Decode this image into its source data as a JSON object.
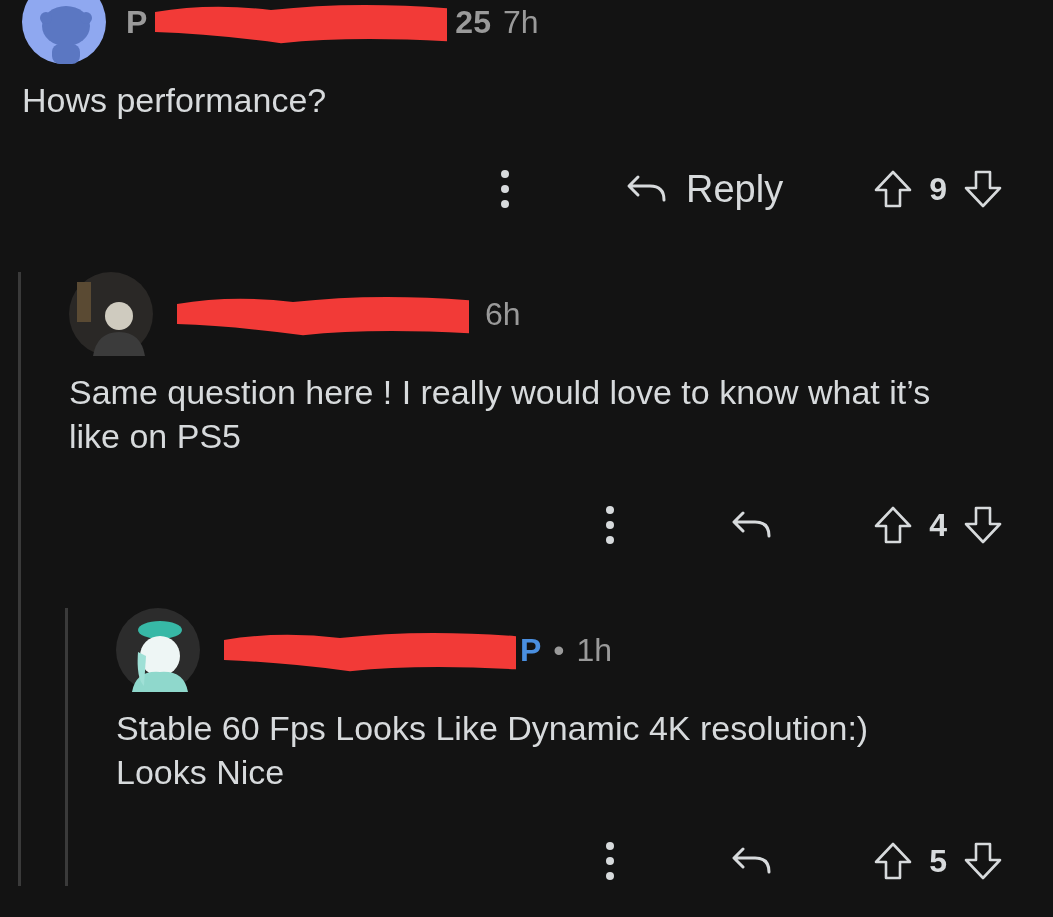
{
  "comments": [
    {
      "avatar": {
        "kind": "robot"
      },
      "name_parts": [
        {
          "kind": "text",
          "text": "P"
        },
        {
          "kind": "redaction"
        },
        {
          "kind": "text",
          "text": "25"
        }
      ],
      "time": "7h",
      "body": "Hows performance?",
      "reply_label": "Reply",
      "score": "9",
      "children": [
        {
          "avatar": {
            "kind": "masked"
          },
          "name_parts": [
            {
              "kind": "redaction"
            }
          ],
          "time": "6h",
          "body": "Same question here ! I really would love to know what it’s like on PS5",
          "score": "4",
          "children": [
            {
              "avatar": {
                "kind": "character"
              },
              "name_parts": [
                {
                  "kind": "redaction"
                },
                {
                  "kind": "op",
                  "text": "P"
                }
              ],
              "separator": "•",
              "time": "1h",
              "body": "Stable 60 Fps Looks Like Dynamic 4K resolution:) Looks Nice",
              "score": "5"
            }
          ]
        }
      ]
    }
  ]
}
